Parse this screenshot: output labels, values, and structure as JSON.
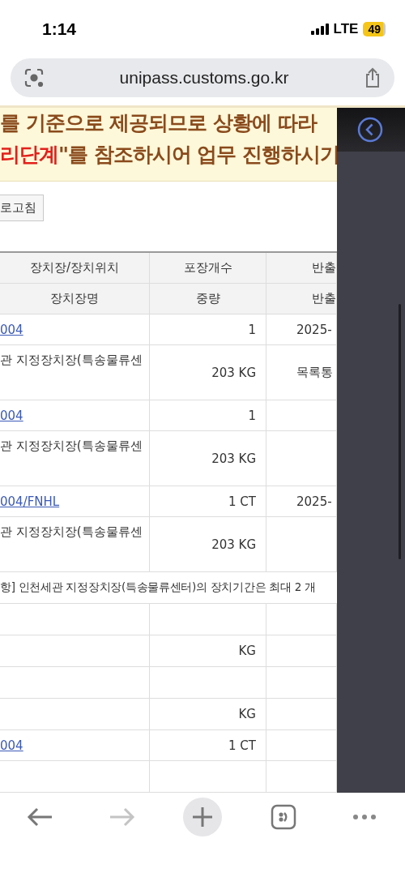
{
  "status_bar": {
    "time": "1:14",
    "network": "LTE",
    "battery": "49"
  },
  "address_bar": {
    "url": "unipass.customs.go.kr"
  },
  "notice": {
    "lines": [
      [
        {
          "text": "를 기준으로 제공되므로 상황에 따라",
          "emphasis": false
        }
      ],
      [
        {
          "text": "리단계",
          "emphasis": true
        },
        {
          "text": "\"를 참조하시어 업무 진행하시기",
          "emphasis": false
        }
      ]
    ]
  },
  "refresh_button": "로고침",
  "table": {
    "header_rows": [
      [
        "장치장/장치위치",
        "포장개수",
        "반출"
      ],
      [
        "장치장명",
        "중량",
        "반출"
      ]
    ],
    "rows": [
      {
        "kind": "link",
        "col1": "004",
        "col2": "1",
        "col3": "2025-"
      },
      {
        "kind": "place",
        "col1": "관 지정장치장(특송물류센",
        "col2": "203 KG",
        "col3": "목록통"
      },
      {
        "kind": "link",
        "col1": "004",
        "col2": "1"
      },
      {
        "kind": "place",
        "col1": "관 지정장치장(특송물류센",
        "col2": "203 KG"
      },
      {
        "kind": "link",
        "col1": "004/FNHL",
        "col2": "1 CT",
        "col3": "2025-"
      },
      {
        "kind": "place",
        "col1": "관 지정장치장(특송물류센",
        "col2": "203 KG"
      },
      {
        "kind": "note",
        "col1": "항] 인천세관 지정장치장(특송물류센터)의 장치기간은 최대 2 개"
      },
      {
        "kind": "plain"
      },
      {
        "kind": "plain",
        "col2": "KG"
      },
      {
        "kind": "plain"
      },
      {
        "kind": "plain",
        "col2": "KG"
      },
      {
        "kind": "link",
        "col1": "004",
        "col2": "1 CT"
      },
      {
        "kind": "plain"
      }
    ]
  },
  "toolbar": {
    "forward_disabled": true
  }
}
